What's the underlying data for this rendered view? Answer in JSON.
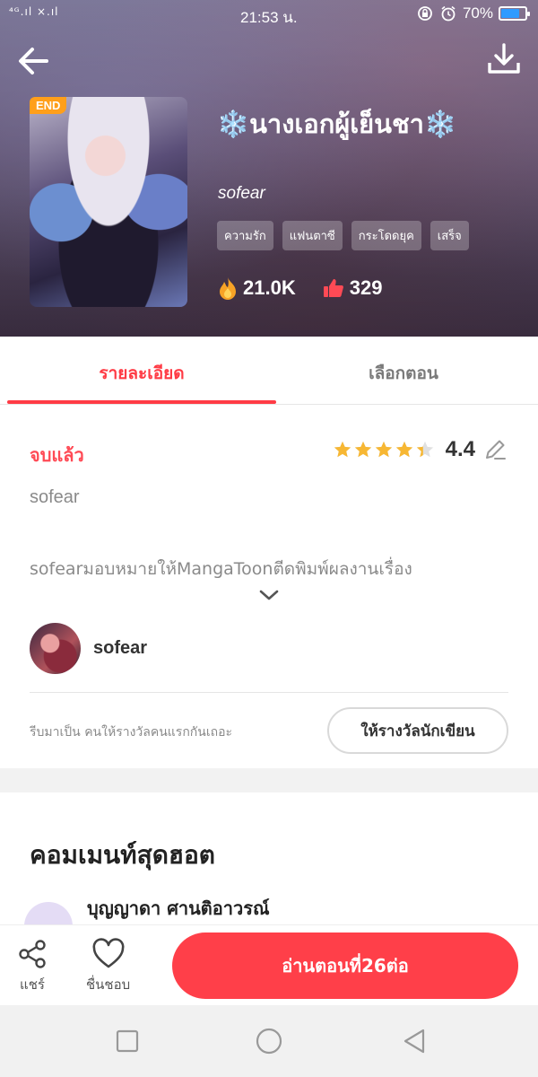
{
  "status_bar": {
    "signal": "⁴ᴳ.ıl ×.ıl",
    "time": "21:53 น.",
    "battery": "70%",
    "battery_level": 0.7
  },
  "hero": {
    "badge": "END",
    "title": "❄️นางเอกผู้เย็นชา❄️",
    "author": "sofear",
    "tags": [
      "ความรัก",
      "แฟนตาซี",
      "กระโดดยุค",
      "เสร็จ"
    ],
    "views": "21.0K",
    "likes": "329"
  },
  "tabs": {
    "details": "รายละเอียด",
    "episodes": "เลือกตอน"
  },
  "details": {
    "status": "จบแล้ว",
    "rating": "4.4",
    "rating_stars": 4.4,
    "author_line": "sofear",
    "description": "sofearมอบหมายให้MangaToonตีดพิมพ์ผลงานเรื่อง"
  },
  "author_row": {
    "name": "sofear"
  },
  "reward": {
    "prompt": "รีบมาเป็น คนให้รางวัลคนแรกกันเถอะ",
    "button": "ให้รางวัลนักเขียน"
  },
  "comments": {
    "title": "คอมเมนท์สุดฮอต",
    "first_commenter": "บุญญาดา ศานติอาวรณ์"
  },
  "actions": {
    "share": "แชร์",
    "like": "ชื่นชอบ",
    "read": "อ่านตอนที่26ต่อ"
  },
  "colors": {
    "accent": "#ff3f49",
    "badge": "#ff9f1a",
    "star": "#f7b733"
  }
}
